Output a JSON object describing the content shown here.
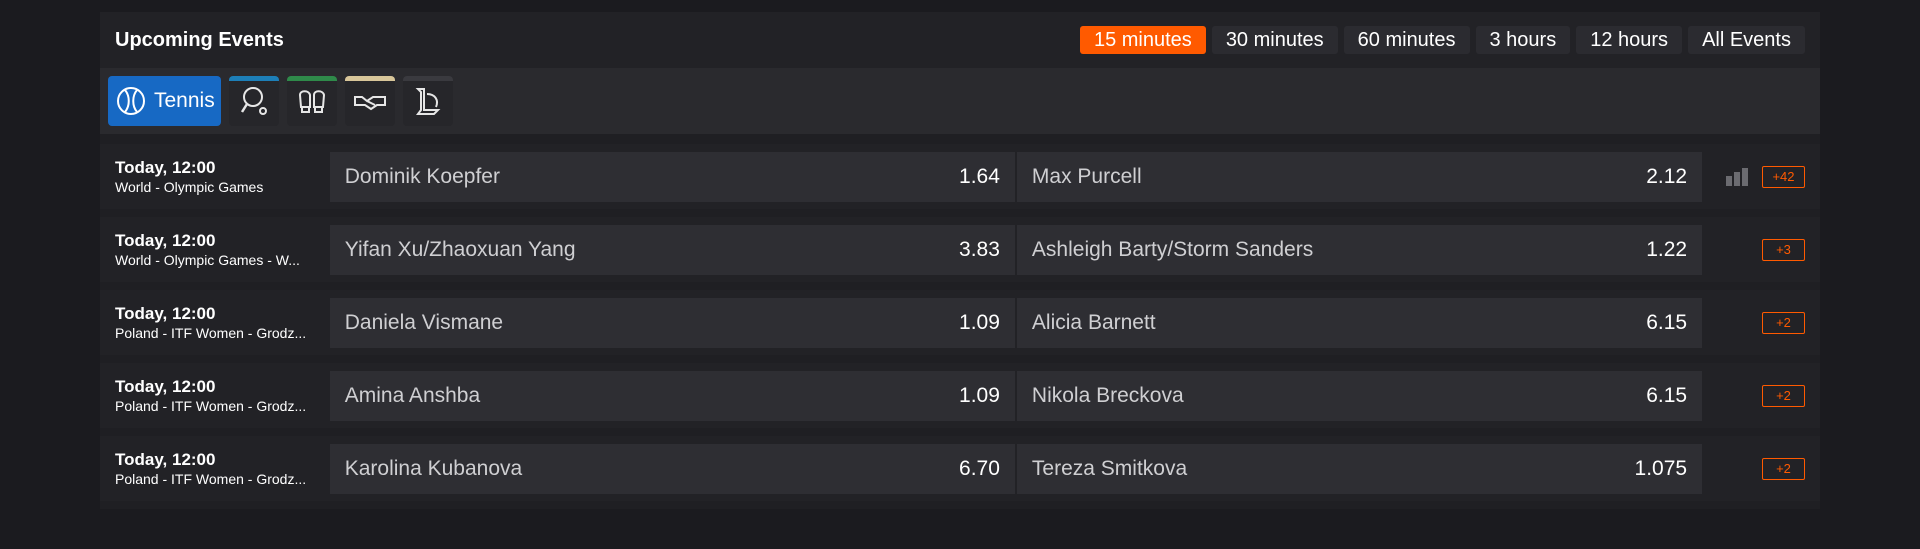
{
  "header": {
    "title": "Upcoming Events",
    "filters": [
      "15 minutes",
      "30 minutes",
      "60 minutes",
      "3 hours",
      "12 hours",
      "All Events"
    ],
    "active_filter_index": 0
  },
  "sports": [
    {
      "label": "Tennis",
      "icon": "tennis-ball-icon",
      "active": true,
      "color": "#1769c4"
    },
    {
      "label": "",
      "icon": "table-tennis-icon",
      "active": false,
      "color": "#1d7fb8"
    },
    {
      "label": "",
      "icon": "boxing-gloves-icon",
      "active": false,
      "color": "#2f8a4a"
    },
    {
      "label": "",
      "icon": "handshake-icon",
      "active": false,
      "color": "#d8c69a"
    },
    {
      "label": "",
      "icon": "league-of-legends-icon",
      "active": false,
      "color": "#3a3a3f"
    }
  ],
  "events": [
    {
      "time": "Today, 12:00",
      "league": "World - Olympic Games",
      "home": "Dominik Koepfer",
      "home_price": "1.64",
      "away": "Max Purcell",
      "away_price": "2.12",
      "more": "+42",
      "has_stats": true
    },
    {
      "time": "Today, 12:00",
      "league": "World - Olympic Games - W...",
      "home": "Yifan Xu/Zhaoxuan Yang",
      "home_price": "3.83",
      "away": "Ashleigh Barty/Storm Sanders",
      "away_price": "1.22",
      "more": "+3",
      "has_stats": false
    },
    {
      "time": "Today, 12:00",
      "league": "Poland - ITF Women - Grodz...",
      "home": "Daniela Vismane",
      "home_price": "1.09",
      "away": "Alicia Barnett",
      "away_price": "6.15",
      "more": "+2",
      "has_stats": false
    },
    {
      "time": "Today, 12:00",
      "league": "Poland - ITF Women - Grodz...",
      "home": "Amina Anshba",
      "home_price": "1.09",
      "away": "Nikola Breckova",
      "away_price": "6.15",
      "more": "+2",
      "has_stats": false
    },
    {
      "time": "Today, 12:00",
      "league": "Poland - ITF Women - Grodz...",
      "home": "Karolina Kubanova",
      "home_price": "6.70",
      "away": "Tereza Smitkova",
      "away_price": "1.075",
      "more": "+2",
      "has_stats": false
    }
  ],
  "colors": {
    "accent": "#ff5a00",
    "active_sport": "#1769c4"
  }
}
